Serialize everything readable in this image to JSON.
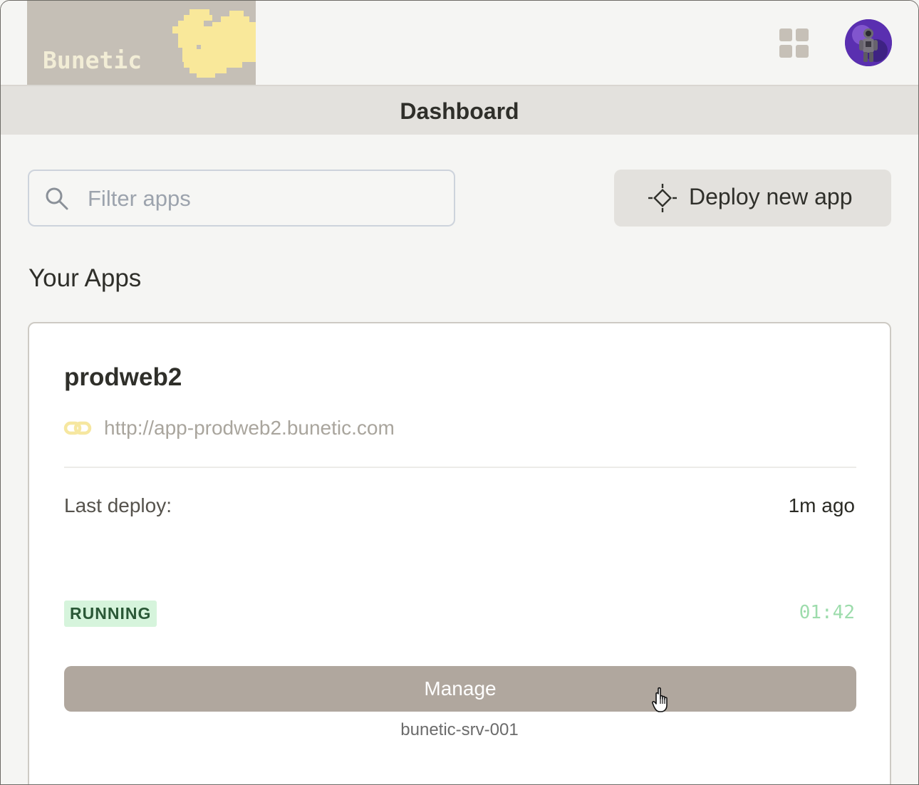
{
  "brand": {
    "name": "Bunetic",
    "colors": {
      "logo_bg": "#c5bfb6",
      "logo_text": "#f2edd6",
      "bunny": "#f9e89a"
    }
  },
  "header": {
    "apps_icon": "grid-icon",
    "avatar_icon": "astronaut-avatar"
  },
  "page": {
    "title": "Dashboard"
  },
  "toolbar": {
    "filter_placeholder": "Filter apps",
    "filter_value": "",
    "deploy_label": "Deploy new app"
  },
  "apps_section": {
    "title": "Your Apps"
  },
  "apps": [
    {
      "name": "prodweb2",
      "url": "http://app-prodweb2.bunetic.com",
      "last_deploy_label": "Last deploy:",
      "last_deploy_value": "1m ago",
      "status": "RUNNING",
      "timer": "01:42",
      "manage_label": "Manage",
      "server": "bunetic-srv-001"
    }
  ],
  "colors": {
    "status_running_bg": "#d6f4dc",
    "status_running_text": "#2a5836",
    "timer": "#9ddcac",
    "manage_button": "#b0a79e"
  }
}
